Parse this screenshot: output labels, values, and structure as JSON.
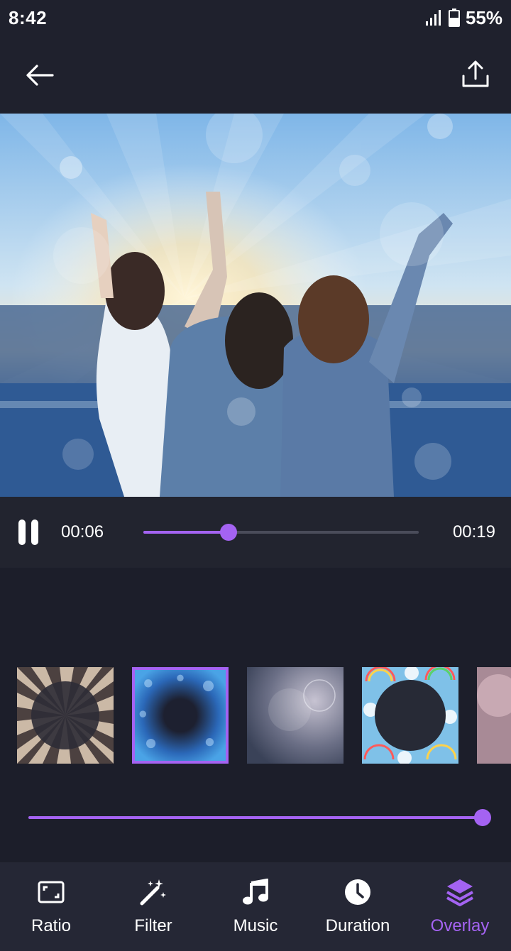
{
  "status_bar": {
    "time": "8:42",
    "battery": "55%"
  },
  "app_bar": {
    "back_icon": "arrow-left-icon",
    "share_icon": "share-upload-icon"
  },
  "player": {
    "current_time": "00:06",
    "total_time": "00:19",
    "progress": 0.31,
    "state": "playing"
  },
  "overlays": {
    "items": [
      {
        "name": "sunburst",
        "selected": false
      },
      {
        "name": "blue-bokeh",
        "selected": true
      },
      {
        "name": "soft-light",
        "selected": false
      },
      {
        "name": "rainbow-clouds",
        "selected": false
      },
      {
        "name": "pink-haze",
        "selected": false
      }
    ],
    "strength": 1.0
  },
  "nav": {
    "items": [
      {
        "label": "Ratio",
        "icon": "aspect-ratio-icon",
        "active": false
      },
      {
        "label": "Filter",
        "icon": "magic-wand-icon",
        "active": false
      },
      {
        "label": "Music",
        "icon": "music-note-icon",
        "active": false
      },
      {
        "label": "Duration",
        "icon": "clock-icon",
        "active": false
      },
      {
        "label": "Overlay",
        "icon": "layers-icon",
        "active": true
      }
    ]
  },
  "colors": {
    "accent": "#a463f2",
    "background": "#1c1e2a",
    "bar": "#252735"
  }
}
